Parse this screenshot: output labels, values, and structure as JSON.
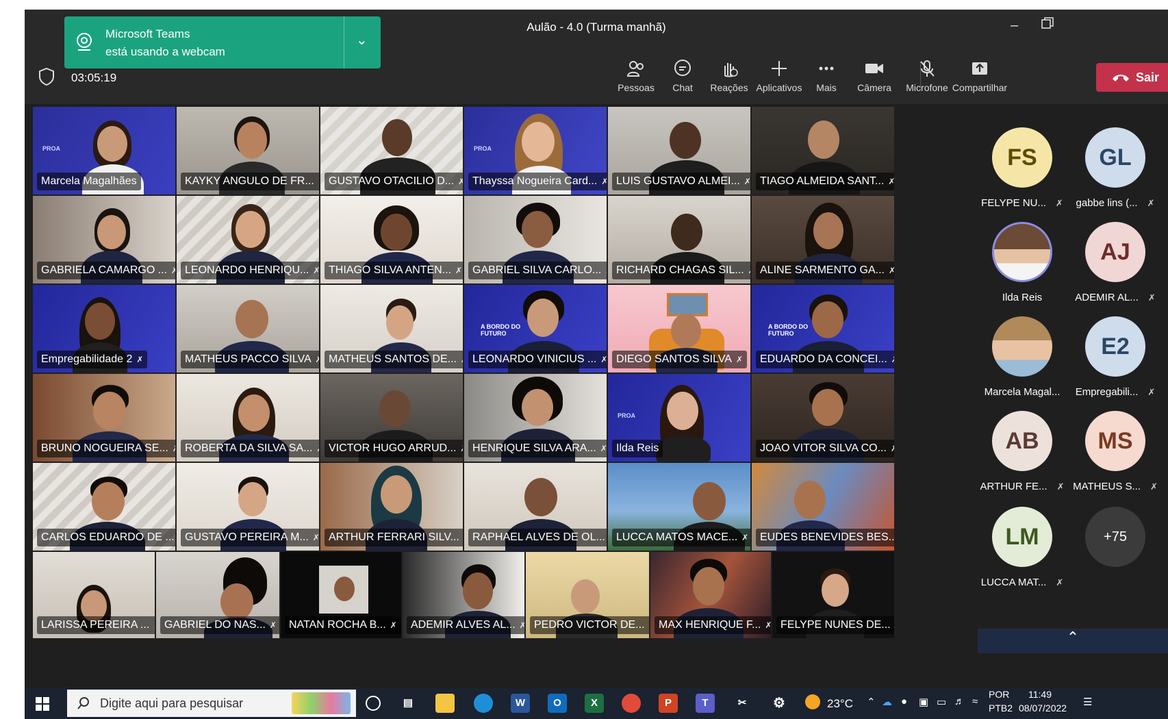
{
  "window": {
    "title": "Aulão - 4.0 (Turma manhã)"
  },
  "toast": {
    "line1": "Microsoft Teams",
    "line2": "está usando a webcam"
  },
  "meeting": {
    "timer": "03:05:19"
  },
  "toolbar": {
    "people": "Pessoas",
    "chat": "Chat",
    "reactions": "Reações",
    "apps": "Aplicativos",
    "more": "Mais",
    "camera": "Câmera",
    "mic": "Microfone",
    "share": "Compartilhar",
    "leave": "Sair"
  },
  "grid": [
    [
      "Marcela Magalhães",
      "KAYKY ANGULO DE FR...",
      "GUSTAVO OTACILIO D...",
      "Thayssa Nogueira Card...",
      "LUIS GUSTAVO ALMEI...",
      "TIAGO ALMEIDA SANT..."
    ],
    [
      "GABRIELA CAMARGO ...",
      "LEONARDO HENRIQU...",
      "THIAGO SILVA ANTEN...",
      "GABRIEL SILVA CARLO...",
      "RICHARD CHAGAS SIL...",
      "ALINE SARMENTO GA..."
    ],
    [
      "Empregabilidade 2",
      "MATHEUS PACCO SILVA",
      "MATHEUS SANTOS DE...",
      "LEONARDO VINICIUS ...",
      "DIEGO SANTOS SILVA",
      "EDUARDO DA CONCEI..."
    ],
    [
      "BRUNO NOGUEIRA SE...",
      "ROBERTA DA SILVA SA...",
      "VICTOR HUGO ARRUD...",
      "HENRIQUE SILVA ARA...",
      "Ilda Reis",
      "JOAO VITOR SILVA CO..."
    ],
    [
      "CARLOS EDUARDO DE ...",
      "GUSTAVO PEREIRA M...",
      "ARTHUR FERRARI SILV...",
      "RAPHAEL ALVES DE OL...",
      "LUCCA MATOS MACE...",
      "EUDES BENEVIDES BES..."
    ],
    [
      "LARISSA PEREIRA ...",
      "GABRIEL DO NAS...",
      "NATAN ROCHA B...",
      "ADEMIR ALVES AL...",
      "PEDRO VICTOR DE...",
      "MAX HENRIQUE F...",
      "FELYPE NUNES DE..."
    ]
  ],
  "grid_overlay_text": {
    "brand": "PROA",
    "banner": "A BORDO DO FUTURO"
  },
  "panel": [
    {
      "initials": "FS",
      "name": "FELYPE NU...",
      "color": "#f5e6a8",
      "text_color": "#5e4a00"
    },
    {
      "initials": "GL",
      "name": "gabbe lins (...",
      "color": "#cfdcec",
      "text_color": "#2b4766"
    },
    {
      "initials": "",
      "name": "Ilda Reis",
      "color": "#e9d7c7",
      "text_color": "#333"
    },
    {
      "initials": "AJ",
      "name": "ADEMIR AL...",
      "color": "#f0d6d4",
      "text_color": "#6e2b2b"
    },
    {
      "initials": "",
      "name": "Marcela Magal...",
      "color": "#e8d6c0",
      "text_color": "#333"
    },
    {
      "initials": "E2",
      "name": "Empregabili...",
      "color": "#cfdcec",
      "text_color": "#2b4766"
    },
    {
      "initials": "AB",
      "name": "ARTHUR FE...",
      "color": "#ede1dc",
      "text_color": "#5b3b33"
    },
    {
      "initials": "MS",
      "name": "MATHEUS S...",
      "color": "#f6d9cf",
      "text_color": "#7a3a22"
    },
    {
      "initials": "LM",
      "name": "LUCCA MAT...",
      "color": "#e3ecd6",
      "text_color": "#3d5a1f"
    }
  ],
  "panel_more": "+75",
  "taskbar": {
    "search_placeholder": "Digite aqui para pesquisar",
    "weather": "23°C",
    "lang1": "POR",
    "lang2": "PTB2",
    "time": "11:49",
    "date": "08/07/2022"
  }
}
